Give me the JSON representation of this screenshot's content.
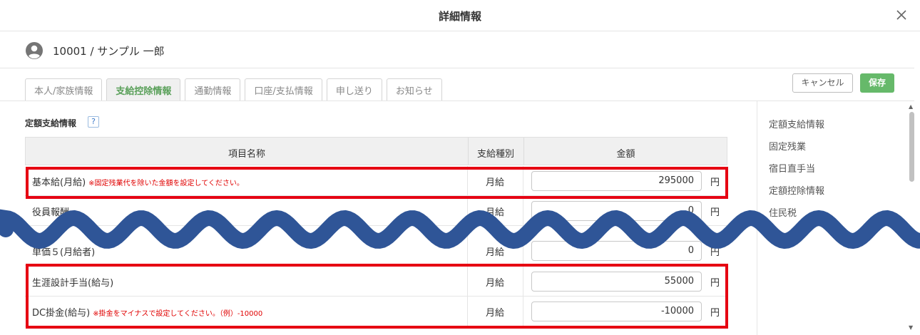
{
  "dialog": {
    "title": "詳細情報"
  },
  "user": {
    "label": "10001 / サンプル 一郎"
  },
  "tabs": [
    {
      "label": "本人/家族情報",
      "active": false
    },
    {
      "label": "支給控除情報",
      "active": true
    },
    {
      "label": "通勤情報",
      "active": false
    },
    {
      "label": "口座/支払情報",
      "active": false
    },
    {
      "label": "申し送り",
      "active": false
    },
    {
      "label": "お知らせ",
      "active": false
    }
  ],
  "actions": {
    "cancel": "キャンセル",
    "save": "保存"
  },
  "section": {
    "title": "定額支給情報",
    "help": "?"
  },
  "table": {
    "headers": {
      "name": "項目名称",
      "kind": "支給種別",
      "amount": "金額"
    },
    "rows": [
      {
        "name": "基本給(月給)",
        "note": "※固定残業代を除いた金額を設定してください。",
        "kind": "月給",
        "amount": "295000",
        "unit": "円"
      },
      {
        "name": "役員報酬",
        "note": "",
        "kind": "月給",
        "amount": "0",
        "unit": "円"
      },
      {
        "name": "単価５(月給者)",
        "note": "",
        "kind": "月給",
        "amount": "0",
        "unit": "円"
      },
      {
        "name": "生涯設計手当(給与)",
        "note": "",
        "kind": "月給",
        "amount": "55000",
        "unit": "円"
      },
      {
        "name": "DC掛金(給与)",
        "note": "※掛金をマイナスで設定してください。（例）-10000",
        "kind": "月給",
        "amount": "-10000",
        "unit": "円"
      }
    ]
  },
  "side_nav": [
    {
      "label": "定額支給情報"
    },
    {
      "label": "固定残業"
    },
    {
      "label": "宿日直手当"
    },
    {
      "label": "定額控除情報"
    },
    {
      "label": "住民税"
    }
  ],
  "colors": {
    "accent": "#66b96a",
    "highlight": "#e60012",
    "wave": "#2f5597",
    "note": "#e00000"
  }
}
